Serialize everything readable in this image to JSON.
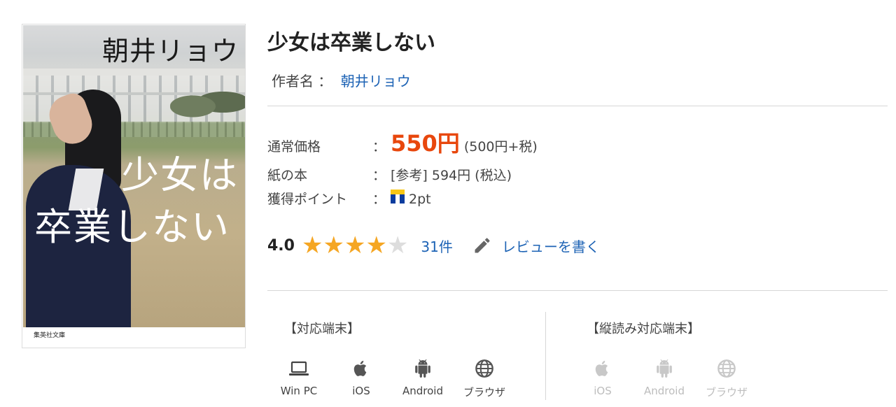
{
  "cover": {
    "author": "朝井リョウ",
    "title_line1": "少女は",
    "title_line2": "卒業しない",
    "publisher": "集英社文庫"
  },
  "book": {
    "title": "少女は卒業しない",
    "author_label": "作者名 ：",
    "author_name": "朝井リョウ"
  },
  "prices": {
    "regular_label": "通常価格",
    "colon": "：",
    "regular_price": "550円",
    "regular_tax_note": "(500円+税)",
    "paper_label": "紙の本",
    "paper_value": "[参考] 594円 (税込)",
    "points_label": "獲得ポイント",
    "points_value": "2pt",
    "points_icon": "tpoint-icon"
  },
  "rating": {
    "score": "4.0",
    "stars_filled": 4,
    "stars_total": 5,
    "count": "31件",
    "write_review": "レビューを書く",
    "star_color": "#f5a623"
  },
  "devices": {
    "label": "【対応端末】",
    "items": [
      {
        "name": "Win PC",
        "icon": "laptop-icon"
      },
      {
        "name": "iOS",
        "icon": "apple-icon"
      },
      {
        "name": "Android",
        "icon": "android-icon"
      },
      {
        "name": "ブラウザ",
        "icon": "globe-icon"
      }
    ]
  },
  "vertical_devices": {
    "label": "【縦読み対応端末】",
    "items": [
      {
        "name": "iOS",
        "icon": "apple-icon"
      },
      {
        "name": "Android",
        "icon": "android-icon"
      },
      {
        "name": "ブラウザ",
        "icon": "globe-icon"
      }
    ]
  },
  "colors": {
    "price": "#e8470d",
    "link": "#1d63b5",
    "disabled": "#bdbdbd"
  }
}
